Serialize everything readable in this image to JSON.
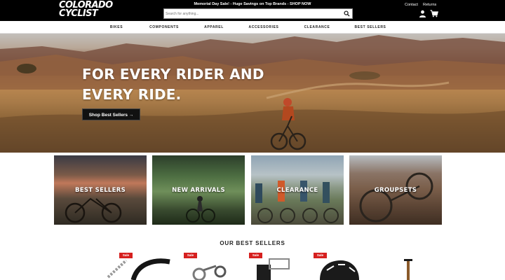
{
  "header": {
    "logo_line1": "COLORADO",
    "logo_line2": "CYCLIST",
    "promo": "Memorial Day Sale! - Huge Savings on Top Brands - SHOP NOW",
    "search_placeholder": "Search for anything...",
    "links": {
      "contact": "Contact",
      "returns": "Returns"
    }
  },
  "nav": {
    "items": [
      "BIKES",
      "COMPONENTS",
      "APPAREL",
      "ACCESSORIES",
      "CLEARANCE",
      "BEST SELLERS"
    ]
  },
  "hero": {
    "title_line1": "FOR EVERY RIDER AND",
    "title_line2": "EVERY RIDE.",
    "cta": "Shop Best Sellers →"
  },
  "categories": [
    "BEST SELLERS",
    "NEW ARRIVALS",
    "CLEARANCE",
    "GROUPSETS"
  ],
  "best_sellers": {
    "title": "OUR BEST SELLERS",
    "badge": "Sale",
    "products": [
      "chain",
      "tire",
      "derailleur",
      "pedals",
      "helmet",
      "dropper-post"
    ]
  },
  "colors": {
    "sale_red": "#d6201f",
    "header_black": "#000000"
  }
}
